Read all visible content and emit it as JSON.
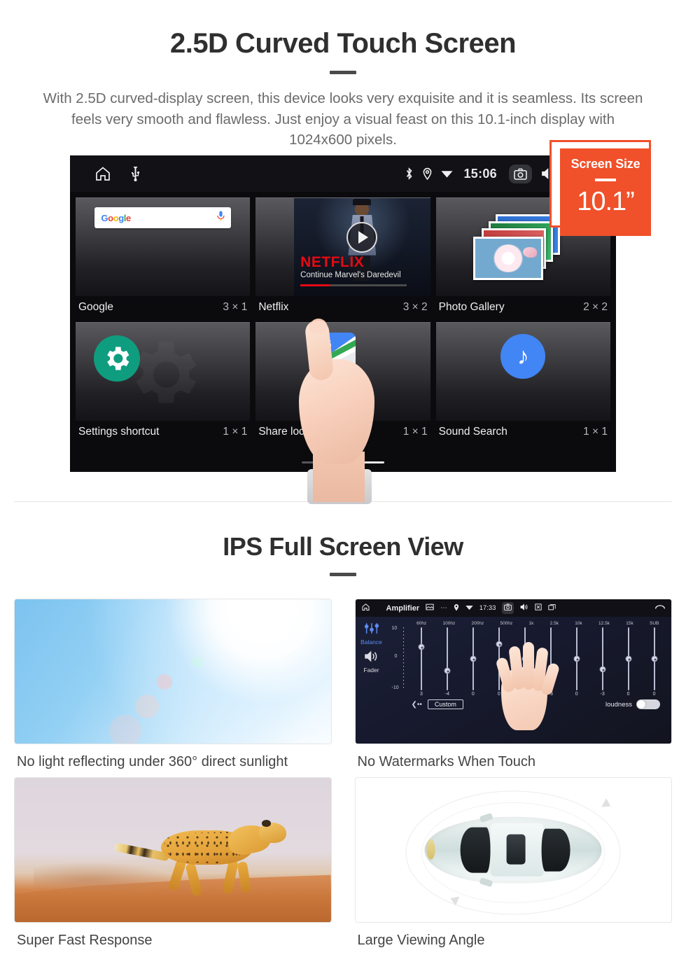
{
  "section1": {
    "title": "2.5D Curved Touch Screen",
    "paragraph": "With 2.5D curved-display screen, this device looks very exquisite and it is seamless. Its screen feels very smooth and flawless. Just enjoy a visual feast on this 10.1-inch display with 1024x600 pixels."
  },
  "badge": {
    "label": "Screen Size",
    "value": "10.1”"
  },
  "device": {
    "statusbar": {
      "left_icons": [
        "home-icon",
        "usb-icon"
      ],
      "right_icons": [
        "bluetooth-icon",
        "location-icon",
        "wifi-icon"
      ],
      "clock": "15:06",
      "trailing_icons": [
        "camera-icon",
        "volume-icon",
        "close-box-icon",
        "recents-icon"
      ]
    },
    "widgets": [
      {
        "name": "Google",
        "size": "3 × 1",
        "icon": "google-search-widget",
        "search_logo": "Google",
        "mic": "mic-icon"
      },
      {
        "name": "Netflix",
        "size": "3 × 2",
        "icon": "netflix-widget",
        "brand": "NETFLIX",
        "subtitle": "Continue Marvel's Daredevil"
      },
      {
        "name": "Photo Gallery",
        "size": "2 × 2",
        "icon": "photo-stack-widget"
      },
      {
        "name": "Settings shortcut",
        "size": "1 × 1",
        "icon": "gear-icon"
      },
      {
        "name": "Share location",
        "size": "1 × 1",
        "icon": "google-maps-icon"
      },
      {
        "name": "Sound Search",
        "size": "1 × 1",
        "icon": "music-note-icon"
      }
    ],
    "page_dots": {
      "count": 3,
      "active_index": 2
    }
  },
  "section2": {
    "title": "IPS Full Screen View",
    "cards": [
      {
        "caption": "No light reflecting under 360° direct sunlight",
        "image": "blue-sky-sun-flare"
      },
      {
        "caption": "No Watermarks When Touch",
        "image": "amplifier-equalizer-screen"
      },
      {
        "caption": "Super Fast Response",
        "image": "running-cheetah"
      },
      {
        "caption": "Large Viewing Angle",
        "image": "car-top-view-orbit"
      }
    ]
  },
  "amplifier": {
    "title": "Amplifier",
    "clock": "17:33",
    "side": {
      "balance": "Balance",
      "fader": "Fader"
    },
    "scale": {
      "max": "10",
      "mid": "0",
      "min": "-10"
    },
    "bands": [
      "60hz",
      "100hz",
      "200hz",
      "500hz",
      "1k",
      "2.5k",
      "10k",
      "12.5k",
      "15k",
      "SUB"
    ],
    "values": [
      "3",
      "-4",
      "0",
      "0",
      "0",
      "-3",
      "0",
      "-3",
      "0",
      "0"
    ],
    "preset": "Custom",
    "loudness_label": "loudness",
    "loudness_on": false
  },
  "colors": {
    "accent_orange": "#F0502A",
    "netflix_red": "#E50914",
    "settings_teal": "#0F9D7F",
    "google_blue": "#4285F4"
  }
}
